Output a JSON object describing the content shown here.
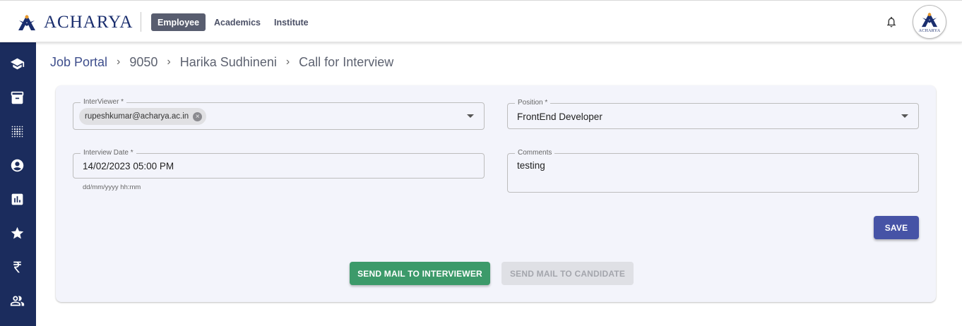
{
  "header": {
    "logo_text": "ACHARYA",
    "tabs": [
      {
        "label": "Employee",
        "active": true
      },
      {
        "label": "Academics",
        "active": false
      },
      {
        "label": "Institute",
        "active": false
      }
    ],
    "avatar_text": "ACHARYA",
    "icons": [
      "bell-icon",
      "acharya-logo-icon"
    ]
  },
  "sidebar": {
    "icons": [
      "school-icon",
      "archive-icon",
      "grid-dots-icon",
      "account-circle-icon",
      "bar-chart-icon",
      "star-icon",
      "rupee-icon",
      "people-icon"
    ]
  },
  "breadcrumb": {
    "items": [
      "Job Portal",
      "9050",
      "Harika Sudhineni",
      "Call for Interview"
    ],
    "separator": "›"
  },
  "form": {
    "interviewer": {
      "label": "InterViewer *",
      "chip": "rupeshkumar@acharya.ac.in"
    },
    "position": {
      "label": "Position *",
      "value": "FrontEnd Developer"
    },
    "interview_date": {
      "label": "Interview Date *",
      "value": "14/02/2023 05:00 PM",
      "helper": "dd/mm/yyyy hh:mm"
    },
    "comments": {
      "label": "Comments",
      "value": "testing"
    }
  },
  "buttons": {
    "save": "SAVE",
    "send_interviewer": "SEND MAIL TO INTERVIEWER",
    "send_candidate": "SEND MAIL TO CANDIDATE"
  },
  "colors": {
    "sidebar": "#1b2c5d",
    "brand": "#1a2e6e",
    "save": "#4653a6",
    "green": "#3c9a6a",
    "card": "#f3f4fb"
  }
}
